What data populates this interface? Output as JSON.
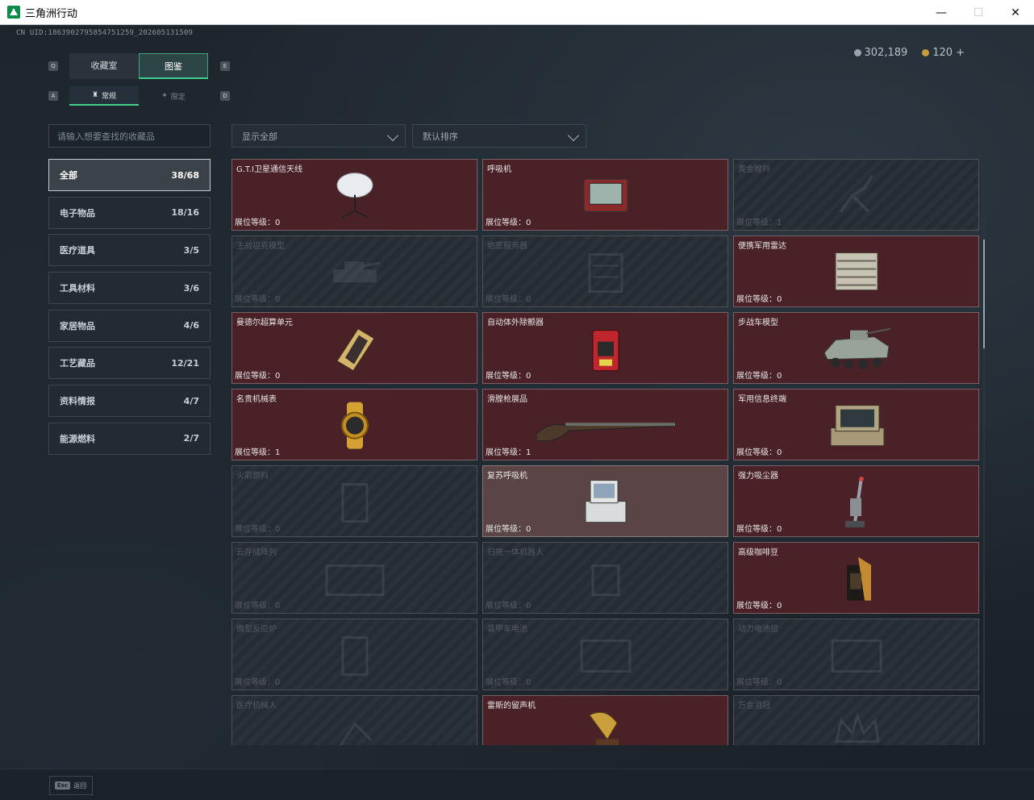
{
  "window": {
    "title": "三角洲行动",
    "minimize": "—",
    "maximize": "☐",
    "close": "✕"
  },
  "header": {
    "uid": "CN UID:1863902795854751259_202605131509",
    "silver": "302,189",
    "gold": "120",
    "gold_plus": "+"
  },
  "tabs": [
    {
      "label": "收藏室",
      "active": false
    },
    {
      "label": "图鉴",
      "active": true
    }
  ],
  "subtabs": [
    {
      "label": "常规",
      "active": true
    },
    {
      "label": "限定",
      "active": false
    }
  ],
  "keys": {
    "q": "Q",
    "e": "E",
    "a": "A",
    "d": "D"
  },
  "search": {
    "placeholder": "请输入想要查找的收藏品"
  },
  "filters": {
    "show": "显示全部",
    "sort": "默认排序"
  },
  "categories": [
    {
      "label": "全部",
      "count": "38/68",
      "active": true
    },
    {
      "label": "电子物品",
      "count": "18/16"
    },
    {
      "label": "医疗道具",
      "count": "3/5"
    },
    {
      "label": "工具材料",
      "count": "3/6"
    },
    {
      "label": "家居物品",
      "count": "4/6"
    },
    {
      "label": "工艺藏品",
      "count": "12/21"
    },
    {
      "label": "资料情报",
      "count": "4/7"
    },
    {
      "label": "能源燃料",
      "count": "2/7"
    }
  ],
  "items": [
    {
      "name": "G.T.I卫星通信天线",
      "level": "展位等级：0",
      "state": "owned",
      "icon": "satellite-dish-icon"
    },
    {
      "name": "呼吸机",
      "level": "展位等级：0",
      "state": "owned",
      "icon": "ventilator-icon"
    },
    {
      "name": "黄金瞪羚",
      "level": "展位等级：1",
      "state": "locked",
      "icon": "gazelle-icon"
    },
    {
      "name": "主战坦克模型",
      "level": "展位等级：0",
      "state": "locked",
      "icon": "tank-icon"
    },
    {
      "name": "绝密服务器",
      "level": "展位等级：0",
      "state": "locked",
      "icon": "server-icon"
    },
    {
      "name": "便携军用雷达",
      "level": "展位等级：0",
      "state": "owned",
      "icon": "radar-icon"
    },
    {
      "name": "曼德尔超算单元",
      "level": "展位等级：0",
      "state": "owned",
      "icon": "chip-icon"
    },
    {
      "name": "自动体外除颤器",
      "level": "展位等级：0",
      "state": "owned",
      "icon": "defibrillator-icon"
    },
    {
      "name": "步战车模型",
      "level": "展位等级：0",
      "state": "owned",
      "icon": "ifv-icon"
    },
    {
      "name": "名贵机械表",
      "level": "展位等级：1",
      "state": "owned",
      "icon": "watch-icon"
    },
    {
      "name": "滑膛枪展品",
      "level": "展位等级：1",
      "state": "owned",
      "icon": "musket-icon"
    },
    {
      "name": "军用信息终端",
      "level": "展位等级：0",
      "state": "owned",
      "icon": "terminal-icon"
    },
    {
      "name": "火箭燃料",
      "level": "展位等级：0",
      "state": "locked",
      "icon": "fuel-icon"
    },
    {
      "name": "复苏呼吸机",
      "level": "展位等级：0",
      "state": "highlight",
      "icon": "resuscitator-icon"
    },
    {
      "name": "强力吸尘器",
      "level": "展位等级：0",
      "state": "owned",
      "icon": "vacuum-icon"
    },
    {
      "name": "云存储阵列",
      "level": "展位等级：0",
      "state": "locked",
      "icon": "storage-icon"
    },
    {
      "name": "扫拖一体机器人",
      "level": "展位等级：0",
      "state": "locked",
      "icon": "robot-icon"
    },
    {
      "name": "高级咖啡豆",
      "level": "展位等级：0",
      "state": "owned",
      "icon": "coffee-icon"
    },
    {
      "name": "微型反应炉",
      "level": "展位等级：0",
      "state": "locked",
      "icon": "reactor-icon"
    },
    {
      "name": "装甲车电池",
      "level": "展位等级：0",
      "state": "locked",
      "icon": "battery-icon"
    },
    {
      "name": "动力电池组",
      "level": "展位等级：0",
      "state": "locked",
      "icon": "battery-pack-icon"
    },
    {
      "name": "医疗机械人",
      "level": "",
      "state": "locked",
      "icon": "medical-robot-icon"
    },
    {
      "name": "雷斯的留声机",
      "level": "",
      "state": "owned",
      "icon": "gramophone-icon"
    },
    {
      "name": "万金泪冠",
      "level": "",
      "state": "locked",
      "icon": "crown-icon"
    }
  ],
  "footer": {
    "esc": "Esc",
    "back": "返回"
  }
}
